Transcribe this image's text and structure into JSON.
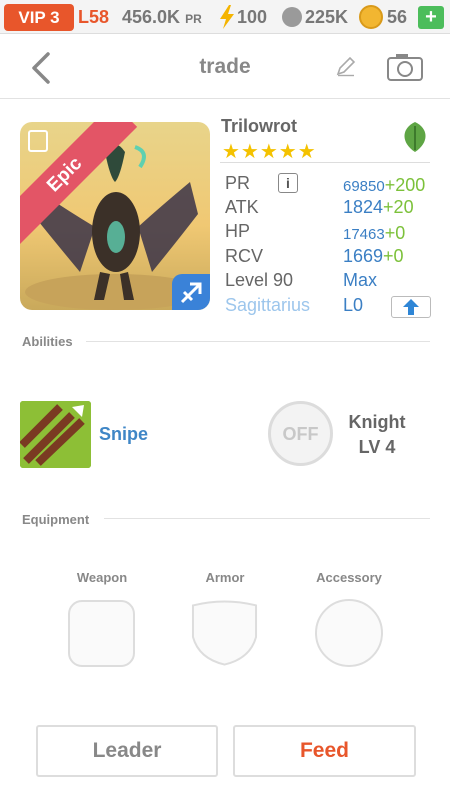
{
  "status_bar": {
    "vip": "VIP 3",
    "level": "L58",
    "power": "456.0K",
    "power_unit": "PR",
    "energy": "100",
    "food": "225K",
    "coins": "56",
    "add_label": "+"
  },
  "nav": {
    "title": "trade"
  },
  "creature": {
    "name": "Trilowrot",
    "rarity": "Epic",
    "stars": "★★★★★",
    "star_count": 5,
    "element": "leaf-icon",
    "stats": {
      "pr_label": "PR",
      "pr_info": "i",
      "pr_value": "69850",
      "pr_bonus": "+200",
      "atk_label": "ATK",
      "atk_value": "1824",
      "atk_bonus": "+20",
      "hp_label": "HP",
      "hp_value": "17463",
      "hp_bonus": "+0",
      "rcv_label": "RCV",
      "rcv_value": "1669",
      "rcv_bonus": "+0",
      "level_label": "Level 90",
      "level_value": "Max",
      "sign_label": "Sagittarius",
      "sign_value": "L0"
    }
  },
  "abilities": {
    "header": "Abilities",
    "ability_name": "Snipe",
    "toggle": "OFF",
    "class_name": "Knight",
    "class_level": "LV 4"
  },
  "equipment": {
    "header": "Equipment",
    "weapon": "Weapon",
    "armor": "Armor",
    "accessory": "Accessory"
  },
  "buttons": {
    "leader": "Leader",
    "feed": "Feed"
  },
  "colors": {
    "accent": "#e8562b",
    "stat_blue": "#3b7fc4",
    "bonus_green": "#7cc13a",
    "epic_red": "#e35566",
    "star_yellow": "#f4c200"
  }
}
